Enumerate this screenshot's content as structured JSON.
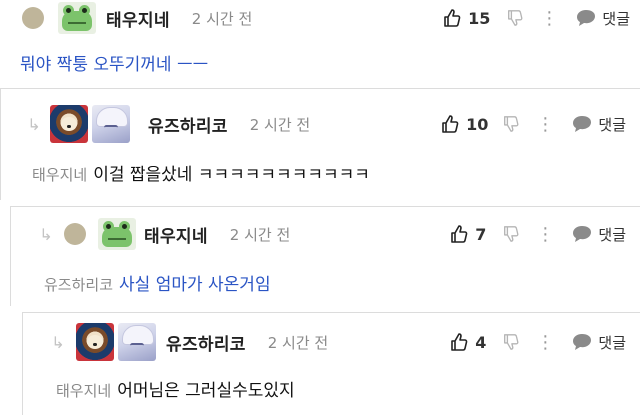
{
  "comments": [
    {
      "author": "태우지네",
      "time": "2 시간 전",
      "likes": "15",
      "reply": "댓글",
      "mention": "",
      "body": "뭐야 짝퉁 오뚜기꺼네 ㅡㅡ",
      "avatar": [
        "dot-avatar",
        "frog-avatar"
      ]
    },
    {
      "author": "유즈하리코",
      "time": "2 시간 전",
      "likes": "10",
      "reply": "댓글",
      "mention": "태우지네",
      "body": "이걸 짭을샀네 ㅋㅋㅋㅋㅋㅋㅋㅋㅋㅋㅋ",
      "avatar": [
        "dog-avatar",
        "anime-avatar"
      ]
    },
    {
      "author": "태우지네",
      "time": "2 시간 전",
      "likes": "7",
      "reply": "댓글",
      "mention": "유즈하리코",
      "body": "사실 엄마가 사온거임",
      "avatar": [
        "dot-avatar",
        "frog-avatar"
      ]
    },
    {
      "author": "유즈하리코",
      "time": "2 시간 전",
      "likes": "4",
      "reply": "댓글",
      "mention": "태우지네",
      "body": "어머님은 그러실수도있지",
      "avatar": [
        "dog-avatar",
        "anime-avatar"
      ]
    }
  ],
  "icons": {
    "like": "thumbs-up-icon",
    "dislike": "thumbs-down-icon",
    "more": "more-dots-icon",
    "reply": "speech-bubble-icon",
    "nested": "reply-arrow-icon"
  },
  "colors": {
    "link": "#2a54c4",
    "muted": "#8a8a8a",
    "divider": "#dcdcdc"
  }
}
